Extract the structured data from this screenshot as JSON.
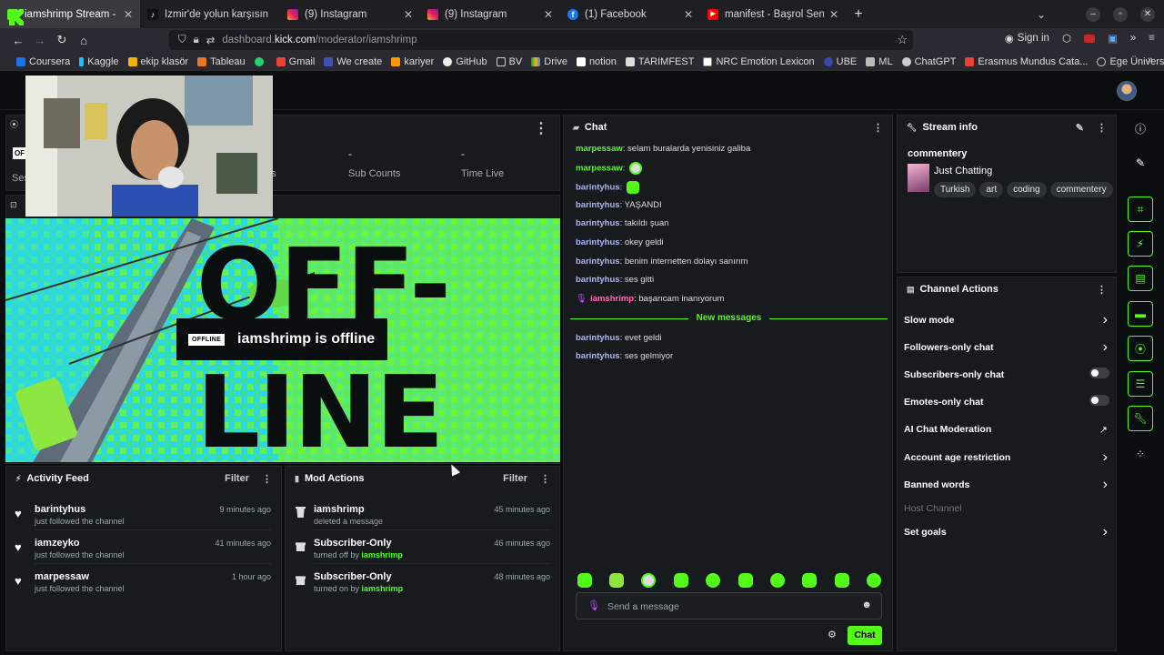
{
  "browser": {
    "tabs": [
      {
        "label": "iamshrimp Stream - Kick D",
        "fav": "kick",
        "active": true
      },
      {
        "label": "İzmir'de yolun karşısın",
        "fav": "tiktok",
        "active": false
      },
      {
        "label": "(9) Instagram",
        "fav": "instagram",
        "active": false
      },
      {
        "label": "(9) Instagram",
        "fav": "instagram",
        "active": false
      },
      {
        "label": "(1) Facebook",
        "fav": "facebook",
        "active": false
      },
      {
        "label": "manifest - Başrol Sensin |",
        "fav": "youtube",
        "active": false
      }
    ],
    "url_host": "dashboard.",
    "url_domain": "kick.com",
    "url_path": "/moderator/iamshrimp",
    "sign_in": "Sign in",
    "bookmarks": [
      "Coursera",
      "Kaggle",
      "ekip klasör",
      "Tableau",
      "",
      "Gmail",
      "We create",
      "kariyer",
      "GitHub",
      "BV",
      "Drive",
      "notion",
      "TARIMFEST",
      "NRC Emotion Lexicon",
      "UBE",
      "ML",
      "ChatGPT",
      "Erasmus Mundus Cata...",
      "Ege Üniversitesi Bilgi ..."
    ]
  },
  "stats": {
    "sessions_label": "Ses",
    "offline_badge_small": "OF",
    "followers_label": "s",
    "sub_counts_value": "-",
    "sub_counts_label": "Sub Counts",
    "time_live_value": "-",
    "time_live_label": "Time Live"
  },
  "video": {
    "offline_tag": "OFFLINE",
    "offline_message": "iamshrimp is offline",
    "bg_text_1": "OFF-",
    "bg_text_2": "LINE"
  },
  "activity_feed": {
    "title": "Activity Feed",
    "filter": "Filter",
    "items": [
      {
        "name": "barintyhus",
        "action": "just followed the channel",
        "time": "9 minutes ago"
      },
      {
        "name": "iamzeyko",
        "action": "just followed the channel",
        "time": "41 minutes ago"
      },
      {
        "name": "marpessaw",
        "action": "just followed the channel",
        "time": "1 hour ago"
      }
    ]
  },
  "mod_actions": {
    "title": "Mod Actions",
    "filter": "Filter",
    "items": [
      {
        "name": "iamshrimp",
        "action": "deleted a message",
        "by": "",
        "time": "45 minutes ago",
        "icon": "trash-icon"
      },
      {
        "name": "Subscriber-Only",
        "action": "turned off by ",
        "by": "iamshrimp",
        "time": "46 minutes ago",
        "icon": "gift-icon"
      },
      {
        "name": "Subscriber-Only",
        "action": "turned on by ",
        "by": "iamshrimp",
        "time": "48 minutes ago",
        "icon": "gift-icon"
      }
    ]
  },
  "chat": {
    "title": "Chat",
    "messages": [
      {
        "user": "marpessaw",
        "text": "selam buralarda yenisiniz galiba",
        "color": "g"
      },
      {
        "user": "marpessaw",
        "text": "",
        "emote": true,
        "color": "g"
      },
      {
        "user": "barintyhus",
        "text": "",
        "emote": true,
        "color": "b"
      },
      {
        "user": "barintyhus",
        "text": "YAŞANDI",
        "color": "b"
      },
      {
        "user": "barintyhus",
        "text": "takıldı şuan",
        "color": "b"
      },
      {
        "user": "barintyhus",
        "text": "okey geldi",
        "color": "b"
      },
      {
        "user": "barintyhus",
        "text": "benim internetten dolayı sanırım",
        "color": "b"
      },
      {
        "user": "barintyhus",
        "text": "ses gitti",
        "color": "b"
      },
      {
        "user": "iamshrimp",
        "text": "başarıcam inanıyorum",
        "color": "p"
      }
    ],
    "new_messages_label": "New messages",
    "new_messages": [
      {
        "user": "barintyhus",
        "text": "evet geldi"
      },
      {
        "user": "barintyhus",
        "text": "ses gelmiyor"
      }
    ],
    "input_placeholder": "Send a message",
    "send_button": "Chat"
  },
  "stream_info": {
    "title": "Stream info",
    "stream_title": "commentery",
    "category": "Just Chatting",
    "tags": [
      "Turkish",
      "art",
      "coding",
      "commentery"
    ]
  },
  "channel_actions": {
    "title": "Channel Actions",
    "items": [
      {
        "label": "Slow mode",
        "control": "chevron"
      },
      {
        "label": "Followers-only chat",
        "control": "chevron"
      },
      {
        "label": "Subscribers-only chat",
        "control": "toggle"
      },
      {
        "label": "Emotes-only chat",
        "control": "toggle"
      },
      {
        "label": "AI Chat Moderation",
        "control": "external"
      },
      {
        "label": "Account age restriction",
        "control": "chevron"
      },
      {
        "label": "Banned words",
        "control": "chevron"
      },
      {
        "label": "Host Channel",
        "control": "none"
      },
      {
        "label": "Set goals",
        "control": "chevron"
      }
    ]
  },
  "colors": {
    "accent": "#53fc18",
    "bg": "#0b0e0f",
    "panel": "#181b1d"
  }
}
